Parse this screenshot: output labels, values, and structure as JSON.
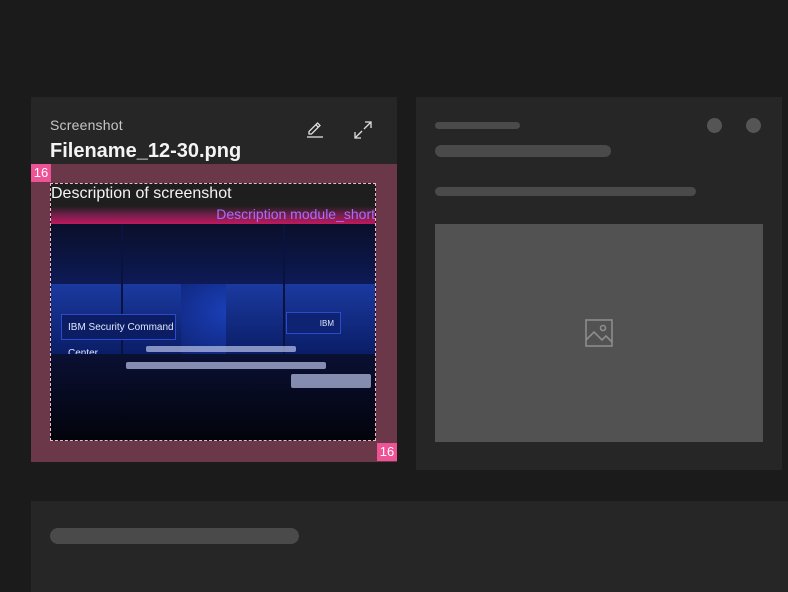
{
  "left_card": {
    "eyebrow": "Screenshot",
    "filename": "Filename_12-30.png",
    "edit_icon": "edit-icon",
    "maximize_icon": "maximize-icon",
    "spacing_top": "16",
    "spacing_bottom": "16",
    "description": "Description of screenshot",
    "module_tag": "Description module_short",
    "photo": {
      "screen_left_text": "IBM Security Command Center",
      "screen_right_text": "IBM"
    }
  },
  "right_card": {
    "dots": [
      "dot-icon",
      "dot-icon"
    ],
    "image_placeholder_icon": "image-icon"
  },
  "colors": {
    "background": "#1b1b1b",
    "card": "#262626",
    "spacing_overlay": "#6a3849",
    "badge": "#ee5396",
    "tag_text": "#a56eff",
    "skeleton": "#4a4a4a",
    "placeholder": "#525252"
  }
}
